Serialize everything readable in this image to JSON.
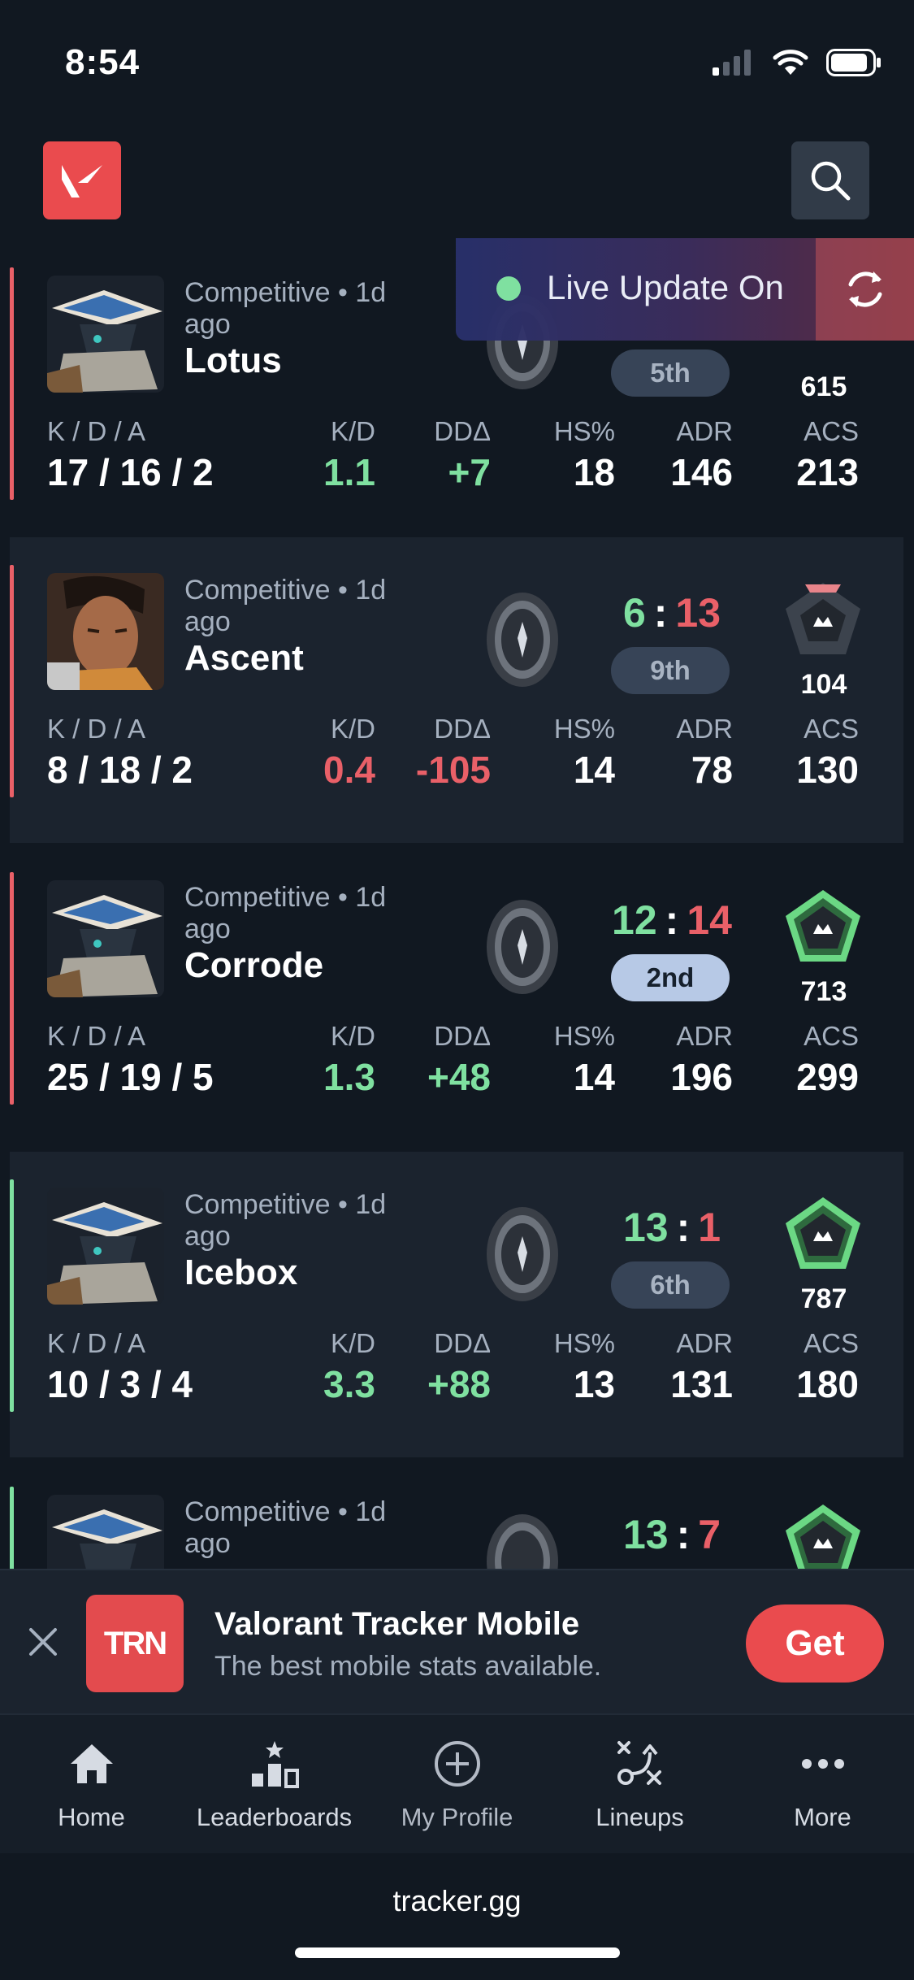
{
  "status_bar": {
    "time": "8:54"
  },
  "header": {
    "logo_icon": "valorant-icon",
    "search_icon": "search-icon"
  },
  "live_update": {
    "label": "Live Update On",
    "dot_color": "#7fe0a0"
  },
  "colors": {
    "win": "#7fe0a0",
    "loss": "#e96068",
    "accent": "#ea4b4e"
  },
  "matches": [
    {
      "mode": "Competitive • 1d ago",
      "map": "Lotus",
      "score_team": "",
      "score_enemy": "",
      "place": "5th",
      "rr": "615",
      "stats": {
        "kda_label": "K / D / A",
        "kda": "17 / 16 / 2",
        "kd_label": "K/D",
        "kd": "1.1",
        "dd_label": "DDΔ",
        "dd": "+7",
        "hs_label": "HS%",
        "hs": "18",
        "adr_label": "ADR",
        "adr": "146",
        "acs_label": "ACS",
        "acs": "213"
      },
      "result": "loss"
    },
    {
      "mode": "Competitive • 1d ago",
      "map": "Ascent",
      "score_team": "6",
      "score_enemy": "13",
      "place": "9th",
      "rr": "104",
      "stats": {
        "kda_label": "K / D / A",
        "kda": "8 / 18 / 2",
        "kd_label": "K/D",
        "kd": "0.4",
        "dd_label": "DDΔ",
        "dd": "-105",
        "hs_label": "HS%",
        "hs": "14",
        "adr_label": "ADR",
        "adr": "78",
        "acs_label": "ACS",
        "acs": "130"
      },
      "result": "loss"
    },
    {
      "mode": "Competitive • 1d ago",
      "map": "Corrode",
      "score_team": "12",
      "score_enemy": "14",
      "place": "2nd",
      "rr": "713",
      "stats": {
        "kda_label": "K / D / A",
        "kda": "25 / 19 / 5",
        "kd_label": "K/D",
        "kd": "1.3",
        "dd_label": "DDΔ",
        "dd": "+48",
        "hs_label": "HS%",
        "hs": "14",
        "adr_label": "ADR",
        "adr": "196",
        "acs_label": "ACS",
        "acs": "299"
      },
      "result": "loss"
    },
    {
      "mode": "Competitive • 1d ago",
      "map": "Icebox",
      "score_team": "13",
      "score_enemy": "1",
      "place": "6th",
      "rr": "787",
      "stats": {
        "kda_label": "K / D / A",
        "kda": "10 / 3 / 4",
        "kd_label": "K/D",
        "kd": "3.3",
        "dd_label": "DDΔ",
        "dd": "+88",
        "hs_label": "HS%",
        "hs": "13",
        "adr_label": "ADR",
        "adr": "131",
        "acs_label": "ACS",
        "acs": "180"
      },
      "result": "win"
    },
    {
      "mode": "Competitive • 1d ago",
      "score_team": "13",
      "score_enemy": "7",
      "result": "win"
    }
  ],
  "app_banner": {
    "badge": "TRN",
    "title": "Valorant Tracker Mobile",
    "subtitle": "The best mobile stats available.",
    "cta": "Get"
  },
  "bottom_nav": [
    {
      "label": "Home",
      "icon": "home-icon"
    },
    {
      "label": "Leaderboards",
      "icon": "leaderboards-icon"
    },
    {
      "label": "My Profile",
      "icon": "add-circle-icon"
    },
    {
      "label": "Lineups",
      "icon": "lineups-icon"
    },
    {
      "label": "More",
      "icon": "more-icon"
    }
  ],
  "browser": {
    "url": "tracker.gg"
  }
}
